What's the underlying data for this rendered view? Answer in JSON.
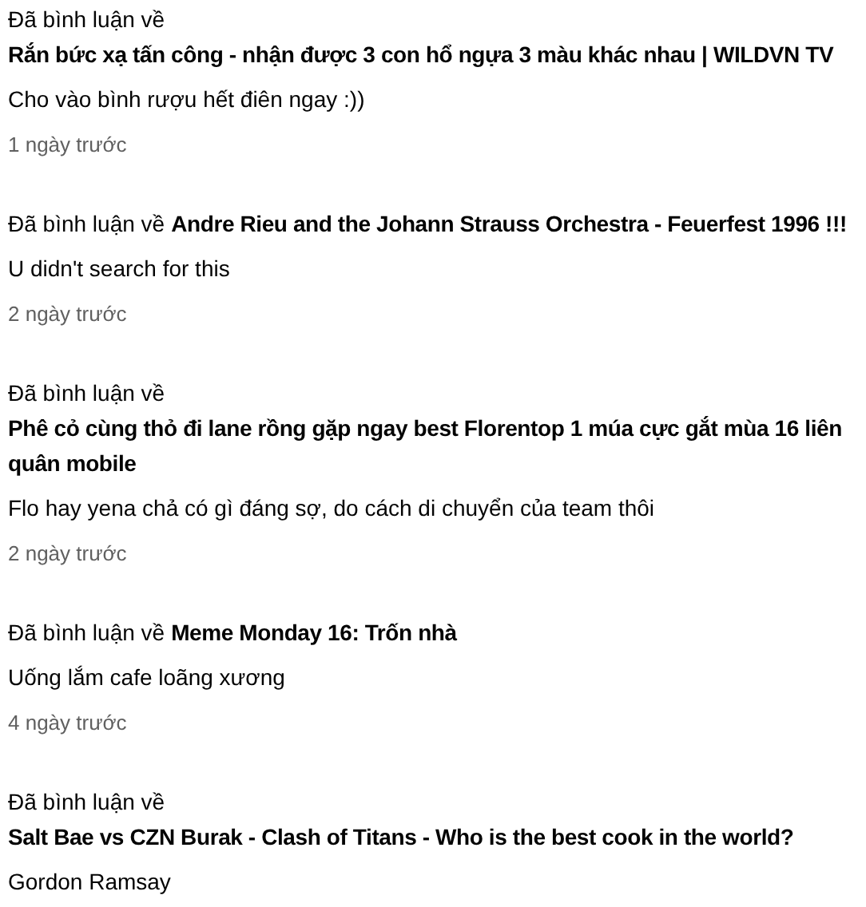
{
  "comments": [
    {
      "prefix": "Đã bình luận về",
      "video_title": "Rắn bức xạ tấn công - nhận được 3 con hổ ngựa 3 màu khác nhau | WILDVN TV",
      "text": "Cho vào bình rượu hết điên ngay :))",
      "time": "1 ngày trước"
    },
    {
      "prefix": "Đã bình luận về",
      "video_title": "Andre Rieu and the Johann Strauss Orchestra - Feuerfest 1996 !!!",
      "text": "U didn't search for this",
      "time": "2 ngày trước"
    },
    {
      "prefix": "Đã bình luận về",
      "video_title": "Phê cỏ cùng thỏ đi lane rồng gặp ngay best Florentop 1 múa cực gắt mùa 16 liên quân mobile",
      "text": "Flo hay yena chả có gì đáng sợ, do cách di chuyển của team thôi",
      "time": "2 ngày trước"
    },
    {
      "prefix": "Đã bình luận về",
      "video_title": "Meme Monday 16: Trốn nhà",
      "text": "Uống lắm cafe loãng xương",
      "time": "4 ngày trước"
    },
    {
      "prefix": "Đã bình luận về",
      "video_title": "Salt Bae vs CZN Burak - Clash of Titans - Who is the best cook in the world?",
      "text": "Gordon Ramsay"
    }
  ]
}
